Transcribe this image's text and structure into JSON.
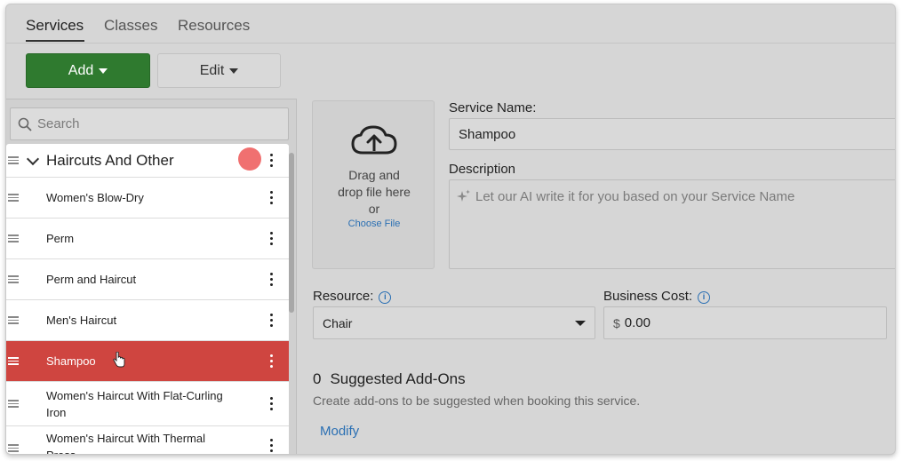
{
  "tabs": [
    {
      "label": "Services",
      "active": true
    },
    {
      "label": "Classes",
      "active": false
    },
    {
      "label": "Resources",
      "active": false
    }
  ],
  "toolbar": {
    "add_label": "Add",
    "edit_label": "Edit"
  },
  "search": {
    "placeholder": "Search"
  },
  "services_list": {
    "group_title": "Haircuts And Other",
    "items": [
      {
        "label": "Women's Blow-Dry",
        "selected": false
      },
      {
        "label": "Perm",
        "selected": false
      },
      {
        "label": "Perm and Haircut",
        "selected": false
      },
      {
        "label": "Men's Haircut",
        "selected": false
      },
      {
        "label": "Shampoo",
        "selected": true
      },
      {
        "label": "Women's Haircut With Flat-Curling Iron",
        "selected": false
      },
      {
        "label": "Women's Haircut With Thermal Press",
        "selected": false
      }
    ]
  },
  "upload": {
    "drag_text_1": "Drag and",
    "drag_text_2": "drop file here",
    "drag_text_3": "or",
    "choose_label": "Choose File"
  },
  "form": {
    "service_name_label": "Service Name:",
    "service_name_value": "Shampoo",
    "description_label": "Description",
    "description_placeholder": "Let our AI write it for you based on your Service Name",
    "resource_label": "Resource:",
    "resource_value": "Chair",
    "business_cost_label": "Business Cost:",
    "business_cost_currency": "$",
    "business_cost_value": "0.00"
  },
  "addons": {
    "count": "0",
    "title": "Suggested Add-Ons",
    "help_text": "Create add-ons to be suggested when booking this service.",
    "modify_label": "Modify"
  },
  "colors": {
    "add_button": "#2f7a2f",
    "selected_row": "#cf4540",
    "link": "#2a6fb3",
    "indicator_dot": "#f07070"
  }
}
